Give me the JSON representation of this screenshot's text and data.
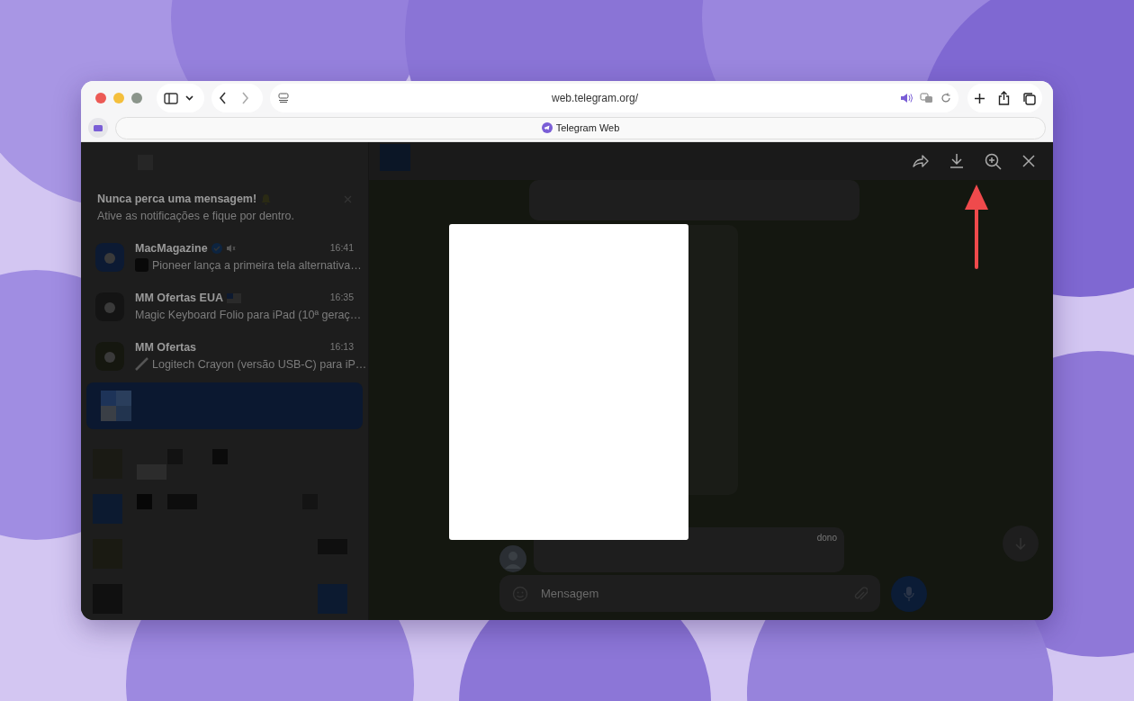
{
  "browser": {
    "url": "web.telegram.org/",
    "tab_title": "Telegram Web"
  },
  "notification_banner": {
    "title": "Nunca perca uma mensagem!",
    "subtitle": "Ative as notificações e fique por dentro."
  },
  "chats": [
    {
      "name": "MacMagazine",
      "verified": true,
      "muted": true,
      "time": "16:41",
      "preview": "Pioneer lança a primeira tela alternativa…",
      "kind": "thumbnail",
      "flag": false,
      "selected": false
    },
    {
      "name": "MM Ofertas EUA",
      "verified": false,
      "muted": false,
      "time": "16:35",
      "preview": "Magic Keyboard Folio para iPad (10ª geraç…",
      "kind": "plain",
      "flag": true,
      "selected": false
    },
    {
      "name": "MM Ofertas",
      "verified": false,
      "muted": false,
      "time": "16:13",
      "preview": "Logitech Crayon (versão USB-C) para iP…",
      "kind": "pencil",
      "flag": false,
      "selected": false
    },
    {
      "selected": true
    }
  ],
  "messages": [
    {
      "time": "dono"
    }
  ],
  "composer": {
    "placeholder": "Mensagem"
  }
}
